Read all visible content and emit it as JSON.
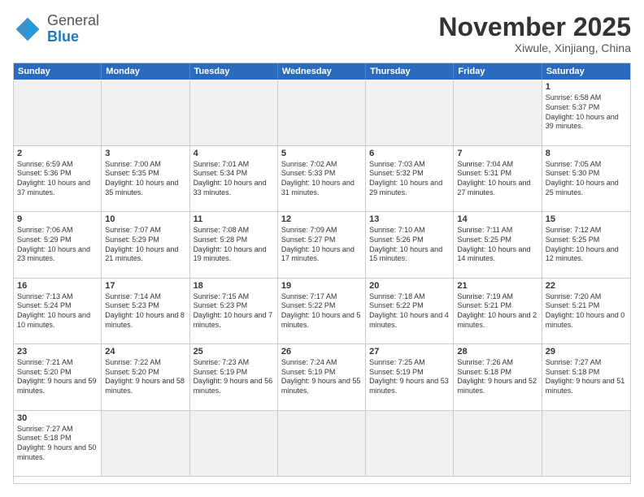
{
  "header": {
    "logo_general": "General",
    "logo_blue": "Blue",
    "month": "November 2025",
    "location": "Xiwule, Xinjiang, China"
  },
  "weekdays": [
    "Sunday",
    "Monday",
    "Tuesday",
    "Wednesday",
    "Thursday",
    "Friday",
    "Saturday"
  ],
  "cells": [
    {
      "day": "",
      "info": "",
      "shaded": true
    },
    {
      "day": "",
      "info": "",
      "shaded": true
    },
    {
      "day": "",
      "info": "",
      "shaded": true
    },
    {
      "day": "",
      "info": "",
      "shaded": true
    },
    {
      "day": "",
      "info": "",
      "shaded": true
    },
    {
      "day": "",
      "info": "",
      "shaded": true
    },
    {
      "day": "1",
      "info": "Sunrise: 6:58 AM\nSunset: 5:37 PM\nDaylight: 10 hours and 39 minutes.",
      "shaded": false
    },
    {
      "day": "2",
      "info": "Sunrise: 6:59 AM\nSunset: 5:36 PM\nDaylight: 10 hours and 37 minutes.",
      "shaded": false
    },
    {
      "day": "3",
      "info": "Sunrise: 7:00 AM\nSunset: 5:35 PM\nDaylight: 10 hours and 35 minutes.",
      "shaded": false
    },
    {
      "day": "4",
      "info": "Sunrise: 7:01 AM\nSunset: 5:34 PM\nDaylight: 10 hours and 33 minutes.",
      "shaded": false
    },
    {
      "day": "5",
      "info": "Sunrise: 7:02 AM\nSunset: 5:33 PM\nDaylight: 10 hours and 31 minutes.",
      "shaded": false
    },
    {
      "day": "6",
      "info": "Sunrise: 7:03 AM\nSunset: 5:32 PM\nDaylight: 10 hours and 29 minutes.",
      "shaded": false
    },
    {
      "day": "7",
      "info": "Sunrise: 7:04 AM\nSunset: 5:31 PM\nDaylight: 10 hours and 27 minutes.",
      "shaded": false
    },
    {
      "day": "8",
      "info": "Sunrise: 7:05 AM\nSunset: 5:30 PM\nDaylight: 10 hours and 25 minutes.",
      "shaded": false
    },
    {
      "day": "9",
      "info": "Sunrise: 7:06 AM\nSunset: 5:29 PM\nDaylight: 10 hours and 23 minutes.",
      "shaded": false
    },
    {
      "day": "10",
      "info": "Sunrise: 7:07 AM\nSunset: 5:29 PM\nDaylight: 10 hours and 21 minutes.",
      "shaded": false
    },
    {
      "day": "11",
      "info": "Sunrise: 7:08 AM\nSunset: 5:28 PM\nDaylight: 10 hours and 19 minutes.",
      "shaded": false
    },
    {
      "day": "12",
      "info": "Sunrise: 7:09 AM\nSunset: 5:27 PM\nDaylight: 10 hours and 17 minutes.",
      "shaded": false
    },
    {
      "day": "13",
      "info": "Sunrise: 7:10 AM\nSunset: 5:26 PM\nDaylight: 10 hours and 15 minutes.",
      "shaded": false
    },
    {
      "day": "14",
      "info": "Sunrise: 7:11 AM\nSunset: 5:25 PM\nDaylight: 10 hours and 14 minutes.",
      "shaded": false
    },
    {
      "day": "15",
      "info": "Sunrise: 7:12 AM\nSunset: 5:25 PM\nDaylight: 10 hours and 12 minutes.",
      "shaded": false
    },
    {
      "day": "16",
      "info": "Sunrise: 7:13 AM\nSunset: 5:24 PM\nDaylight: 10 hours and 10 minutes.",
      "shaded": false
    },
    {
      "day": "17",
      "info": "Sunrise: 7:14 AM\nSunset: 5:23 PM\nDaylight: 10 hours and 8 minutes.",
      "shaded": false
    },
    {
      "day": "18",
      "info": "Sunrise: 7:15 AM\nSunset: 5:23 PM\nDaylight: 10 hours and 7 minutes.",
      "shaded": false
    },
    {
      "day": "19",
      "info": "Sunrise: 7:17 AM\nSunset: 5:22 PM\nDaylight: 10 hours and 5 minutes.",
      "shaded": false
    },
    {
      "day": "20",
      "info": "Sunrise: 7:18 AM\nSunset: 5:22 PM\nDaylight: 10 hours and 4 minutes.",
      "shaded": false
    },
    {
      "day": "21",
      "info": "Sunrise: 7:19 AM\nSunset: 5:21 PM\nDaylight: 10 hours and 2 minutes.",
      "shaded": false
    },
    {
      "day": "22",
      "info": "Sunrise: 7:20 AM\nSunset: 5:21 PM\nDaylight: 10 hours and 0 minutes.",
      "shaded": false
    },
    {
      "day": "23",
      "info": "Sunrise: 7:21 AM\nSunset: 5:20 PM\nDaylight: 9 hours and 59 minutes.",
      "shaded": false
    },
    {
      "day": "24",
      "info": "Sunrise: 7:22 AM\nSunset: 5:20 PM\nDaylight: 9 hours and 58 minutes.",
      "shaded": false
    },
    {
      "day": "25",
      "info": "Sunrise: 7:23 AM\nSunset: 5:19 PM\nDaylight: 9 hours and 56 minutes.",
      "shaded": false
    },
    {
      "day": "26",
      "info": "Sunrise: 7:24 AM\nSunset: 5:19 PM\nDaylight: 9 hours and 55 minutes.",
      "shaded": false
    },
    {
      "day": "27",
      "info": "Sunrise: 7:25 AM\nSunset: 5:19 PM\nDaylight: 9 hours and 53 minutes.",
      "shaded": false
    },
    {
      "day": "28",
      "info": "Sunrise: 7:26 AM\nSunset: 5:18 PM\nDaylight: 9 hours and 52 minutes.",
      "shaded": false
    },
    {
      "day": "29",
      "info": "Sunrise: 7:27 AM\nSunset: 5:18 PM\nDaylight: 9 hours and 51 minutes.",
      "shaded": false
    },
    {
      "day": "30",
      "info": "Sunrise: 7:27 AM\nSunset: 5:18 PM\nDaylight: 9 hours and 50 minutes.",
      "shaded": false
    },
    {
      "day": "",
      "info": "",
      "shaded": true
    },
    {
      "day": "",
      "info": "",
      "shaded": true
    },
    {
      "day": "",
      "info": "",
      "shaded": true
    },
    {
      "day": "",
      "info": "",
      "shaded": true
    },
    {
      "day": "",
      "info": "",
      "shaded": true
    },
    {
      "day": "",
      "info": "",
      "shaded": true
    }
  ]
}
